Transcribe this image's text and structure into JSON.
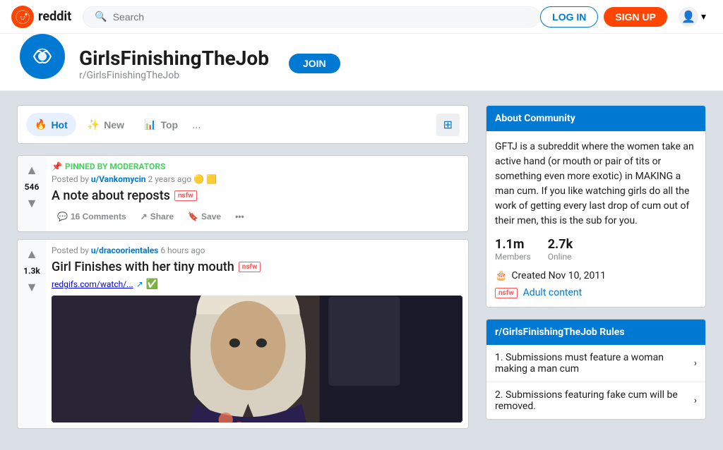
{
  "header": {
    "logo_text": "reddit",
    "search_placeholder": "Search",
    "login_label": "LOG IN",
    "signup_label": "SIGN UP"
  },
  "subreddit": {
    "name": "GirlsFinishingTheJob",
    "slug": "r/GirlsFinishingTheJob",
    "join_label": "JOIN"
  },
  "sort_bar": {
    "hot_label": "Hot",
    "new_label": "New",
    "top_label": "Top",
    "more": "..."
  },
  "posts": [
    {
      "id": "pinned",
      "pinned": true,
      "pinned_label": "PINNED BY MODERATORS",
      "author": "u/Vankomycin",
      "time_ago": "2 years ago",
      "has_award1": true,
      "has_award2": true,
      "title": "A note about reposts",
      "nsfw": true,
      "vote_count": "546",
      "comments_count": "16 Comments",
      "share_label": "Share",
      "save_label": "Save"
    },
    {
      "id": "post1",
      "pinned": false,
      "author": "u/dracoorientales",
      "time_ago": "6 hours ago",
      "title": "Girl Finishes with her tiny mouth",
      "nsfw": true,
      "vote_count": "1.3k",
      "link": "redgifs.com/watch/...",
      "verified": true,
      "has_image": true
    }
  ],
  "sidebar": {
    "about": {
      "header": "About Community",
      "description": "GFTJ is a subreddit where the women take an active hand (or mouth or pair of tits or something even more exotic) in MAKING a man cum. If you like watching girls do all the work of getting every last drop of cum out of their men, this is the sub for you.",
      "members": "1.1m",
      "members_label": "Members",
      "online": "2.7k",
      "online_label": "Online",
      "created": "Created Nov 10, 2011",
      "nsfw_tag": "nsfw",
      "adult_label": "Adult content"
    },
    "rules": {
      "header": "r/GirlsFinishingTheJob Rules",
      "items": [
        {
          "number": "1.",
          "text": "Submissions must feature a woman making a man cum"
        },
        {
          "number": "2.",
          "text": "Submissions featuring fake cum will be removed."
        }
      ]
    }
  }
}
